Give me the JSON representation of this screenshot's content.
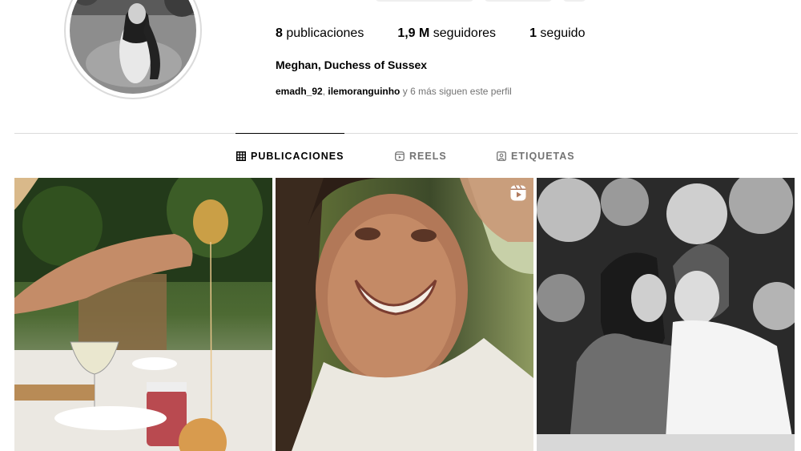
{
  "profile": {
    "stats": {
      "posts_count": "8",
      "posts_label": "publicaciones",
      "followers_count": "1,9 M",
      "followers_label": "seguidores",
      "following_count": "1",
      "following_label": "seguido"
    },
    "full_name": "Meghan, Duchess of Sussex",
    "followed_by": {
      "user1": "emadh_92",
      "separator": ",",
      "user2": "ilemoranguinho",
      "rest": "y 6 más siguen este perfil"
    }
  },
  "tabs": [
    {
      "label": "PUBLICACIONES",
      "icon": "grid-icon",
      "active": true
    },
    {
      "label": "REELS",
      "icon": "reels-icon",
      "active": false
    },
    {
      "label": "ETIQUETAS",
      "icon": "tagged-icon",
      "active": false
    }
  ],
  "posts": [
    {
      "kind": "photo",
      "icon": null
    },
    {
      "kind": "reel",
      "icon": "reel-icon"
    },
    {
      "kind": "photo",
      "icon": null
    }
  ]
}
